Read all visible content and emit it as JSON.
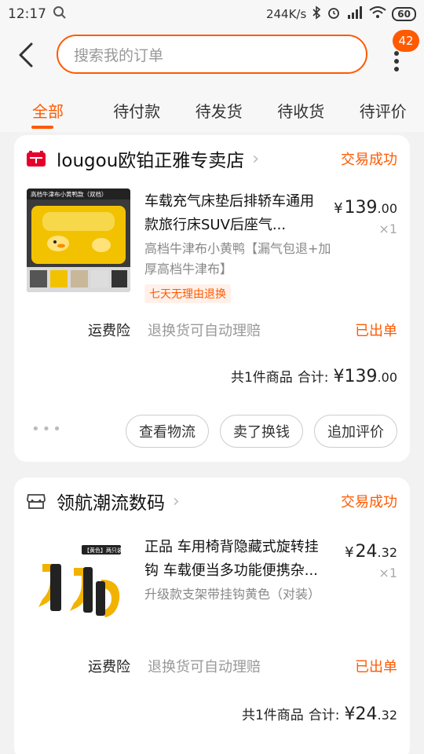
{
  "status_bar": {
    "time": "12:17",
    "network_speed": "244K/s",
    "battery": "60"
  },
  "header": {
    "search_placeholder": "搜索我的订单",
    "notification_count": "42"
  },
  "tabs": [
    {
      "label": "全部",
      "active": true
    },
    {
      "label": "待付款",
      "active": false
    },
    {
      "label": "待发货",
      "active": false
    },
    {
      "label": "待收货",
      "active": false
    },
    {
      "label": "待评价",
      "active": false
    }
  ],
  "orders": [
    {
      "shop_name": "lougou欧铂正雅专卖店",
      "shop_icon": "tmall-icon",
      "status": "交易成功",
      "product": {
        "title": "车载充气床垫后排轿车通用款旅行床SUV后座气...",
        "spec": "高档牛津布小黄鸭【漏气包退+加厚高档牛津布】",
        "price_currency": "¥",
        "price_int": "139",
        "price_dec": ".00",
        "quantity": "×1",
        "return_tag": "七天无理由退换",
        "image_caption": "高档牛津布小黄鸭款（双档）"
      },
      "insurance": {
        "label": "运费险",
        "desc": "退换货可自动理赔",
        "status": "已出单"
      },
      "total": {
        "count_text": "共1件商品",
        "sum_label": "合计:",
        "currency": "¥",
        "int": "139",
        "dec": ".00"
      },
      "more": "•••",
      "actions": [
        "查看物流",
        "卖了换钱",
        "追加评价"
      ]
    },
    {
      "shop_name": "领航潮流数码",
      "shop_icon": "store-icon",
      "status": "交易成功",
      "product": {
        "title": "正品 车用椅背隐藏式旋转挂钩 车载便当多功能便携杂...",
        "spec": "升级款支架带挂钩黄色（对装）",
        "price_currency": "¥",
        "price_int": "24",
        "price_dec": ".32",
        "quantity": "×1",
        "image_caption": "【黄色】两只装"
      },
      "insurance": {
        "label": "运费险",
        "desc": "退换货可自动理赔",
        "status": "已出单"
      },
      "total": {
        "count_text": "共1件商品",
        "sum_label": "合计:",
        "currency": "¥",
        "int": "24",
        "dec": ".32"
      }
    }
  ],
  "colors": {
    "accent": "#ff5a00",
    "background": "#f2f2f2",
    "card": "#ffffff"
  }
}
